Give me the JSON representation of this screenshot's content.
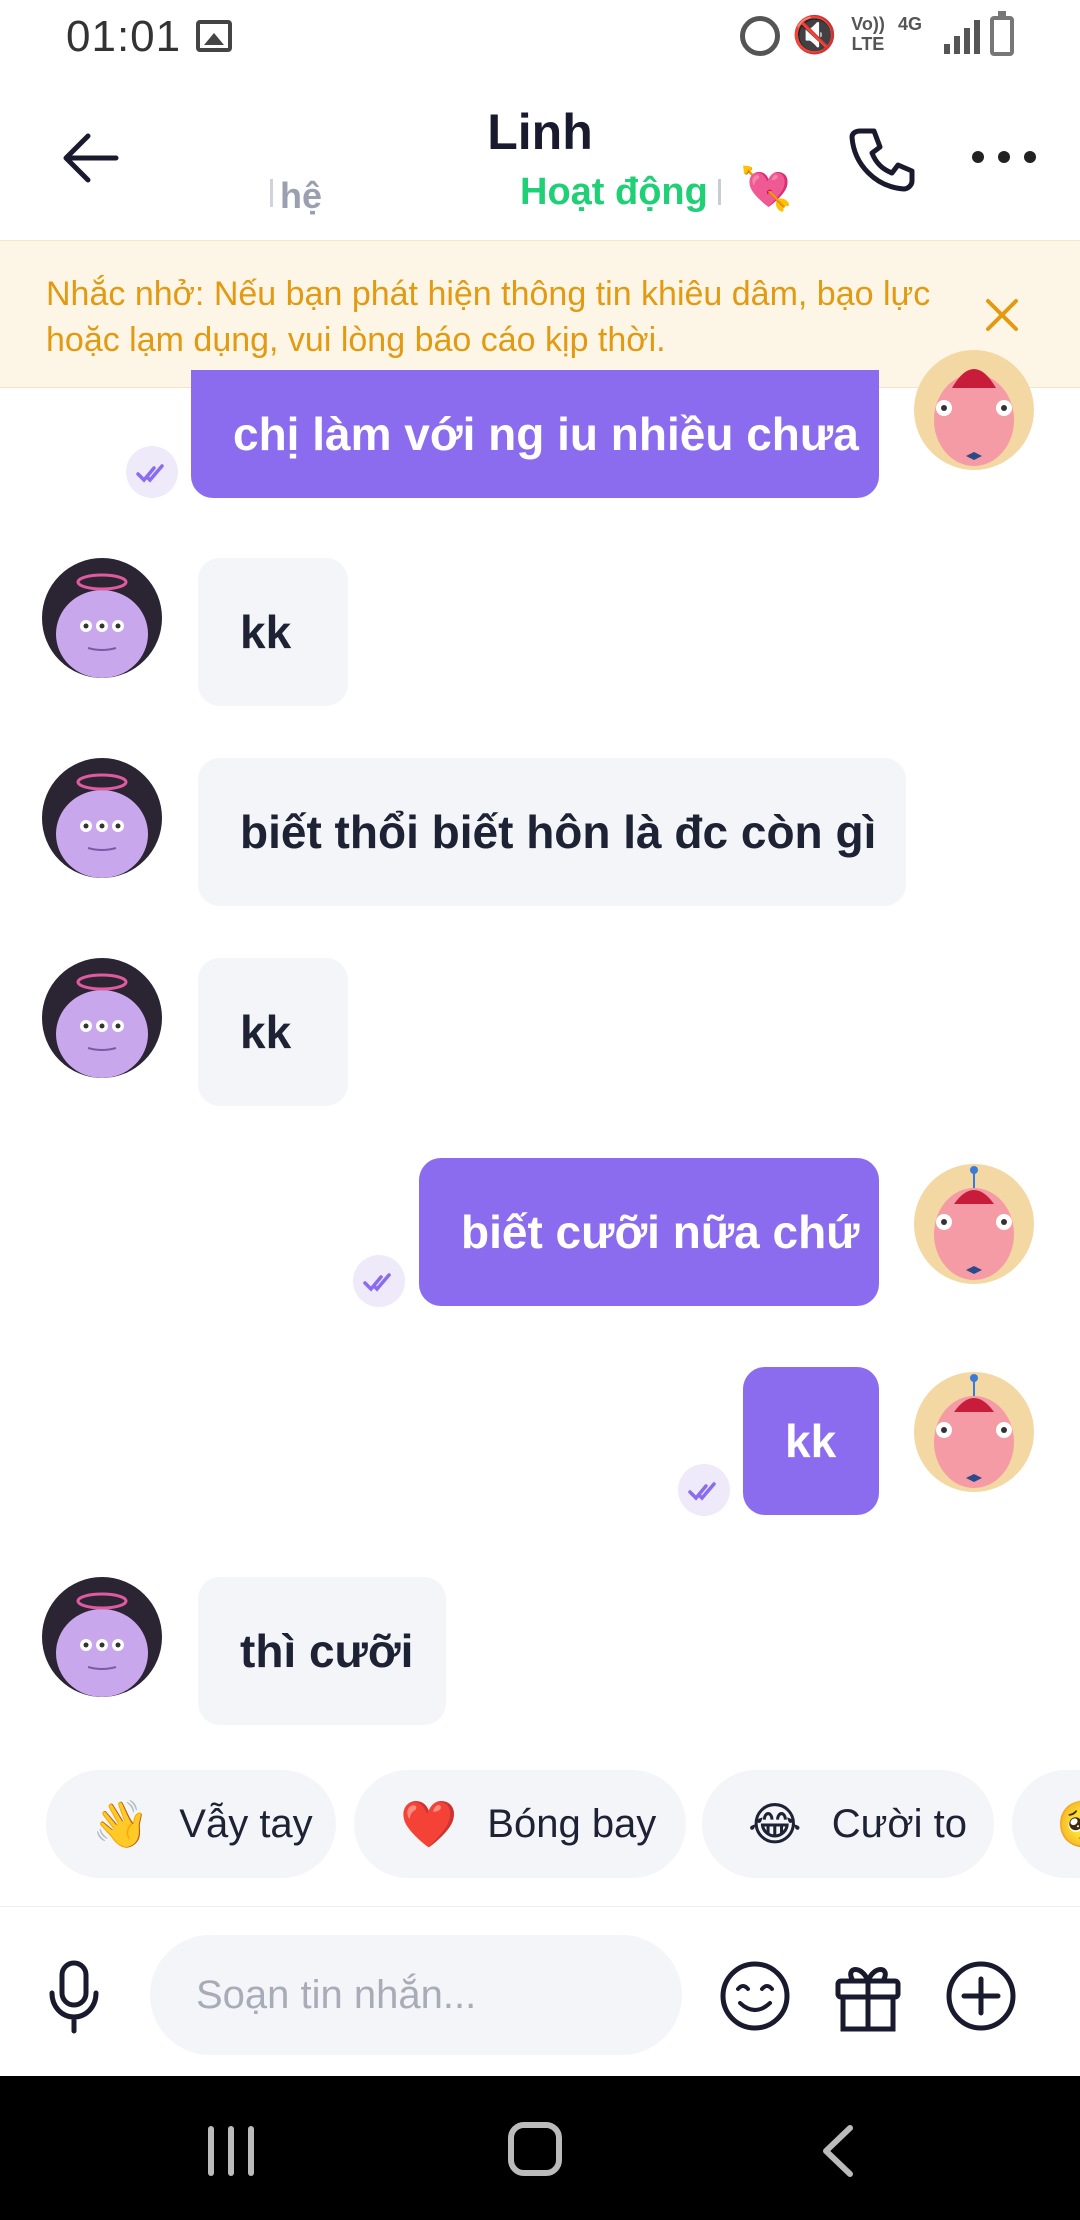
{
  "status_bar": {
    "time": "01:01",
    "volte": "Vo)) LTE",
    "network": "4G"
  },
  "header": {
    "title": "Linh",
    "subtitle_left": "hệ",
    "presence": "Hoạt động",
    "presence_color": "#20d077",
    "heart_emoji": "💘"
  },
  "reminder": {
    "text": "Nhắc nhở: Nếu bạn phát hiện thông tin khiêu dâm, bạo lực hoặc lạm dụng, vui lòng báo cáo kịp thời.",
    "color": "#e29a12"
  },
  "messages": [
    {
      "from": "self",
      "text": "chị làm với ng iu nhiều chưa"
    },
    {
      "from": "other",
      "text": "kk"
    },
    {
      "from": "other",
      "text": "biết thổi biết hôn là đc còn gì"
    },
    {
      "from": "other",
      "text": "kk"
    },
    {
      "from": "self",
      "text": "biết cưỡi nữa chứ"
    },
    {
      "from": "self",
      "text": "kk"
    },
    {
      "from": "other",
      "text": "thì cưỡi"
    }
  ],
  "quick_reactions": [
    {
      "emoji": "👋",
      "label": "Vẫy tay"
    },
    {
      "emoji": "❤️",
      "label": "Bóng bay"
    },
    {
      "emoji": "😂",
      "label": "Cười to"
    },
    {
      "emoji": "🥺",
      "label": ""
    }
  ],
  "composer": {
    "placeholder": "Soạn tin nhắn..."
  },
  "colors": {
    "self_bubble": "#8c6cee",
    "other_bubble": "#f4f5f8"
  },
  "icons": [
    "back-arrow-icon",
    "phone-icon",
    "more-icon",
    "close-icon",
    "read-check-icon",
    "microphone-icon",
    "emoji-icon",
    "gift-icon",
    "plus-icon"
  ]
}
